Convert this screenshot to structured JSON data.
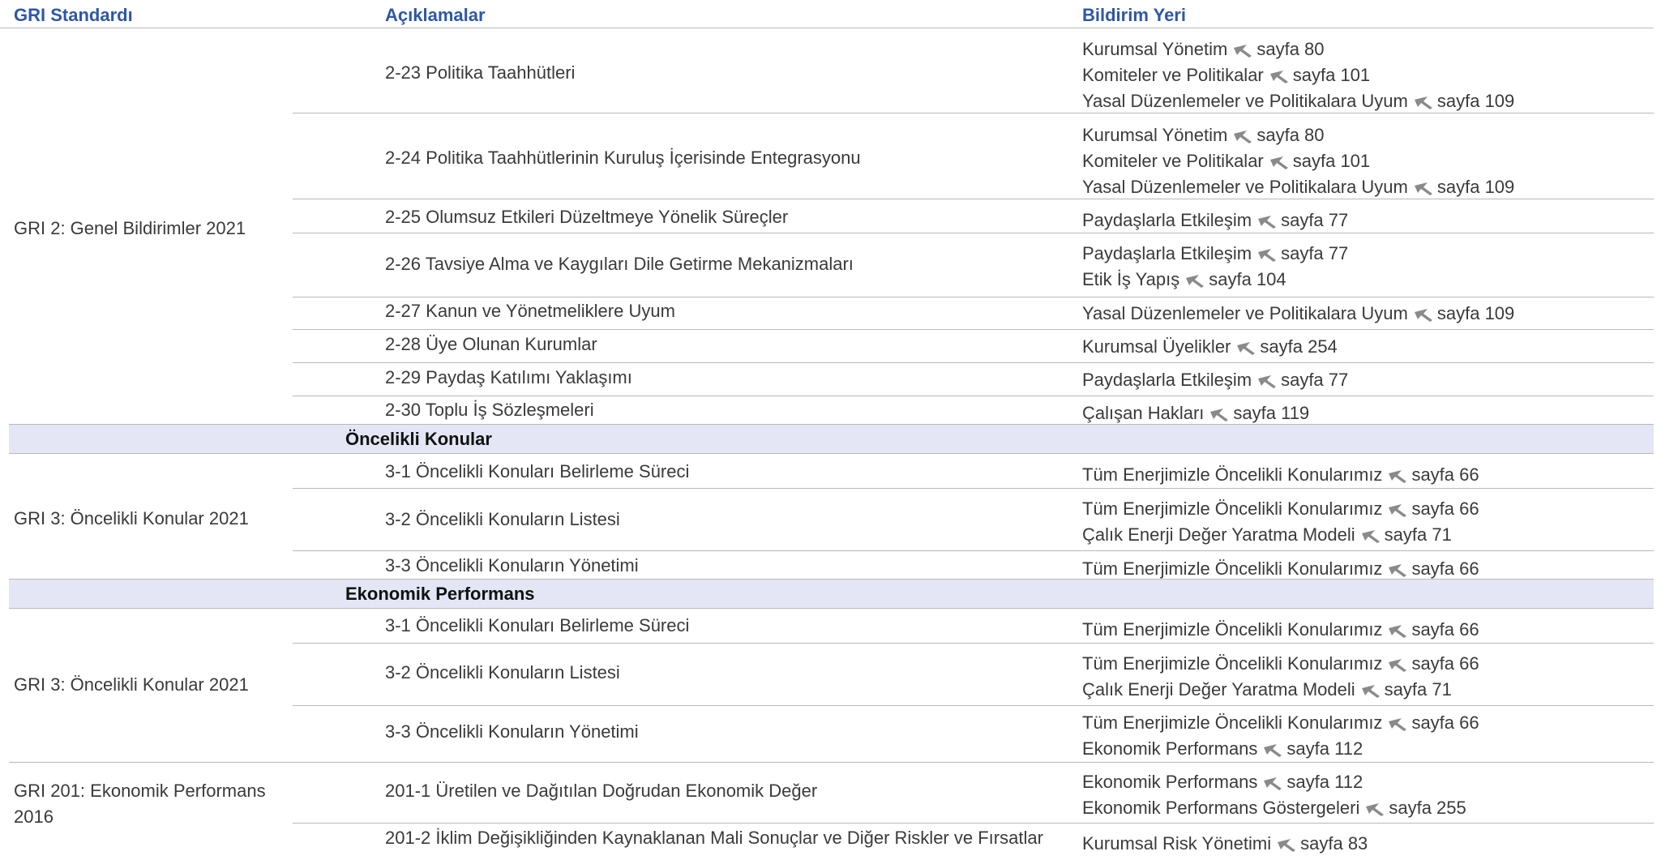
{
  "headers": {
    "standard": "GRI Standardı",
    "explanations": "Açıklamalar",
    "location": "Bildirim Yeri"
  },
  "sections": [
    {
      "title": "Öncelikli Konular"
    },
    {
      "title": "Ekonomik Performans"
    }
  ],
  "standards": [
    "GRI 2: Genel Bildirimler 2021",
    "GRI 3: Öncelikli Konular 2021",
    "GRI 3: Öncelikli Konular 2021",
    "GRI 201: Ekonomik Performans 2016"
  ],
  "rows": [
    {
      "desc": "2-23 Politika Taahhütleri",
      "refs": [
        {
          "name": "Kurumsal Yönetim",
          "page": "sayfa 80"
        },
        {
          "name": "Komiteler ve Politikalar",
          "page": "sayfa 101"
        },
        {
          "name": "Yasal Düzenlemeler ve Politikalara Uyum",
          "page": "sayfa 109"
        }
      ]
    },
    {
      "desc": "2-24 Politika Taahhütlerinin Kuruluş İçerisinde Entegrasyonu",
      "refs": [
        {
          "name": "Kurumsal Yönetim",
          "page": "sayfa 80"
        },
        {
          "name": "Komiteler ve Politikalar",
          "page": "sayfa 101"
        },
        {
          "name": "Yasal Düzenlemeler ve Politikalara Uyum",
          "page": "sayfa 109"
        }
      ]
    },
    {
      "desc": "2-25 Olumsuz Etkileri Düzeltmeye Yönelik Süreçler",
      "refs": [
        {
          "name": "Paydaşlarla Etkileşim",
          "page": "sayfa 77"
        }
      ]
    },
    {
      "desc": "2-26 Tavsiye Alma ve Kaygıları Dile Getirme Mekanizmaları",
      "refs": [
        {
          "name": "Paydaşlarla Etkileşim",
          "page": "sayfa 77"
        },
        {
          "name": "Etik İş Yapış",
          "page": "sayfa 104"
        }
      ]
    },
    {
      "desc": "2-27 Kanun ve Yönetmeliklere Uyum",
      "refs": [
        {
          "name": "Yasal Düzenlemeler ve Politikalara Uyum",
          "page": "sayfa 109"
        }
      ]
    },
    {
      "desc": "2-28 Üye Olunan Kurumlar",
      "refs": [
        {
          "name": "Kurumsal Üyelikler",
          "page": "sayfa 254"
        }
      ]
    },
    {
      "desc": "2-29 Paydaş Katılımı Yaklaşımı",
      "refs": [
        {
          "name": "Paydaşlarla Etkileşim",
          "page": "sayfa 77"
        }
      ]
    },
    {
      "desc": "2-30 Toplu İş Sözleşmeleri",
      "refs": [
        {
          "name": "Çalışan Hakları",
          "page": "sayfa 119"
        }
      ]
    },
    {
      "desc": "3-1 Öncelikli Konuları Belirleme Süreci",
      "refs": [
        {
          "name": "Tüm Enerjimizle Öncelikli Konularımız",
          "page": "sayfa 66"
        }
      ]
    },
    {
      "desc": "3-2 Öncelikli Konuların Listesi",
      "refs": [
        {
          "name": "Tüm Enerjimizle Öncelikli Konularımız",
          "page": "sayfa 66"
        },
        {
          "name": "Çalık Enerji Değer Yaratma Modeli",
          "page": "sayfa 71"
        }
      ]
    },
    {
      "desc": "3-3 Öncelikli Konuların Yönetimi",
      "refs": [
        {
          "name": "Tüm Enerjimizle Öncelikli Konularımız",
          "page": "sayfa 66"
        }
      ]
    },
    {
      "desc": "3-1 Öncelikli Konuları Belirleme Süreci",
      "refs": [
        {
          "name": "Tüm Enerjimizle Öncelikli Konularımız",
          "page": "sayfa 66"
        }
      ]
    },
    {
      "desc": "3-2 Öncelikli Konuların Listesi",
      "refs": [
        {
          "name": "Tüm Enerjimizle Öncelikli Konularımız",
          "page": "sayfa 66"
        },
        {
          "name": "Çalık Enerji Değer Yaratma Modeli",
          "page": "sayfa 71"
        }
      ]
    },
    {
      "desc": "3-3 Öncelikli Konuların Yönetimi",
      "refs": [
        {
          "name": "Tüm Enerjimizle Öncelikli Konularımız",
          "page": "sayfa 66"
        },
        {
          "name": "Ekonomik Performans",
          "page": "sayfa 112"
        }
      ]
    },
    {
      "desc": "201-1 Üretilen ve Dağıtılan Doğrudan Ekonomik Değer",
      "refs": [
        {
          "name": "Ekonomik Performans",
          "page": "sayfa 112"
        },
        {
          "name": "Ekonomik Performans Göstergeleri",
          "page": "sayfa 255"
        }
      ]
    },
    {
      "desc": "201-2 İklim Değişikliğinden Kaynaklanan Mali Sonuçlar ve Diğer Riskler ve Fırsatlar",
      "refs": [
        {
          "name": "Kurumsal Risk Yönetimi",
          "page": "sayfa 83"
        }
      ]
    }
  ]
}
